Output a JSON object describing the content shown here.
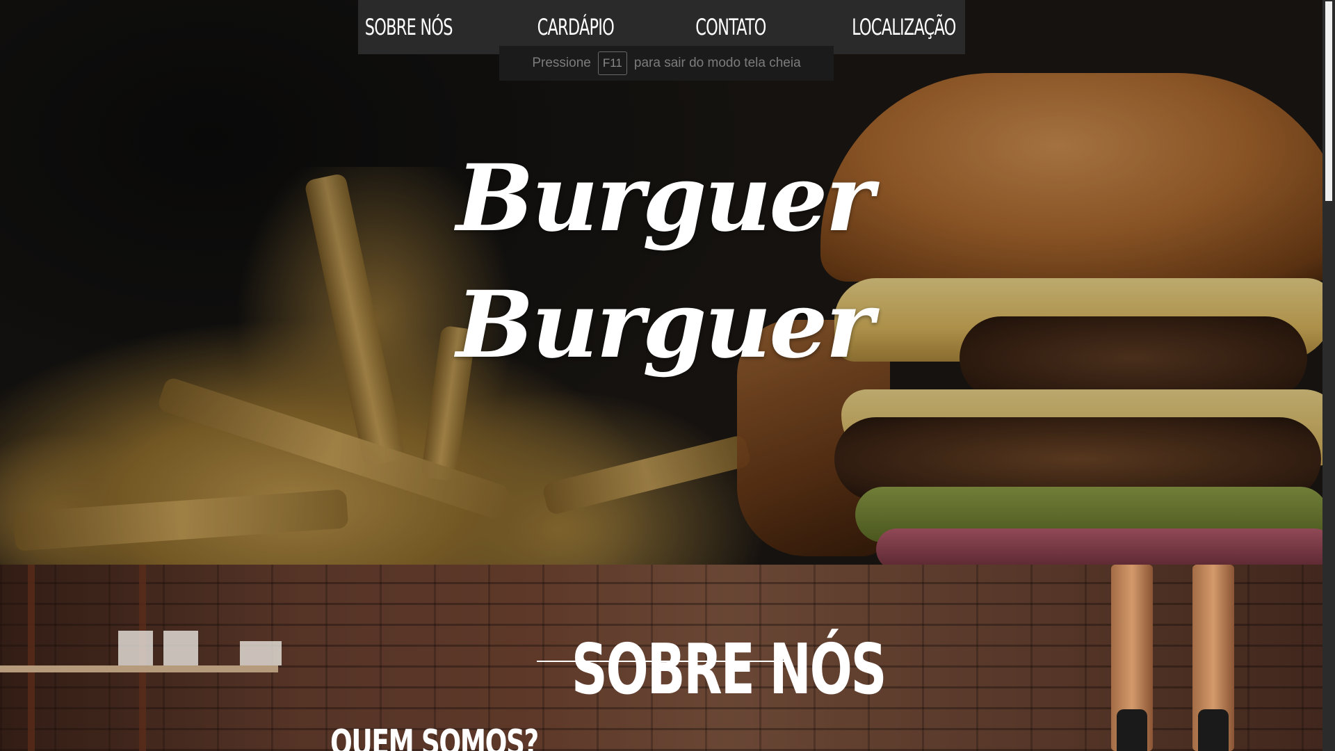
{
  "nav": {
    "items": [
      {
        "label": "SOBRE NÓS"
      },
      {
        "label": "CARDÁPIO"
      },
      {
        "label": "CONTATO"
      },
      {
        "label": "LOCALIZAÇÃO"
      }
    ]
  },
  "fullscreen_notice": {
    "prefix": "Pressione",
    "key": "F11",
    "suffix": "para sair do modo tela cheia"
  },
  "hero": {
    "title_line_1": "Burguer",
    "title_line_2": "Burguer"
  },
  "about": {
    "title": "SOBRE NÓS",
    "subtitle": "QUEM SOMOS?"
  },
  "colors": {
    "nav_bg": "#2a2a2b",
    "text": "#ffffff",
    "notice_text": "#7c7c7c"
  }
}
